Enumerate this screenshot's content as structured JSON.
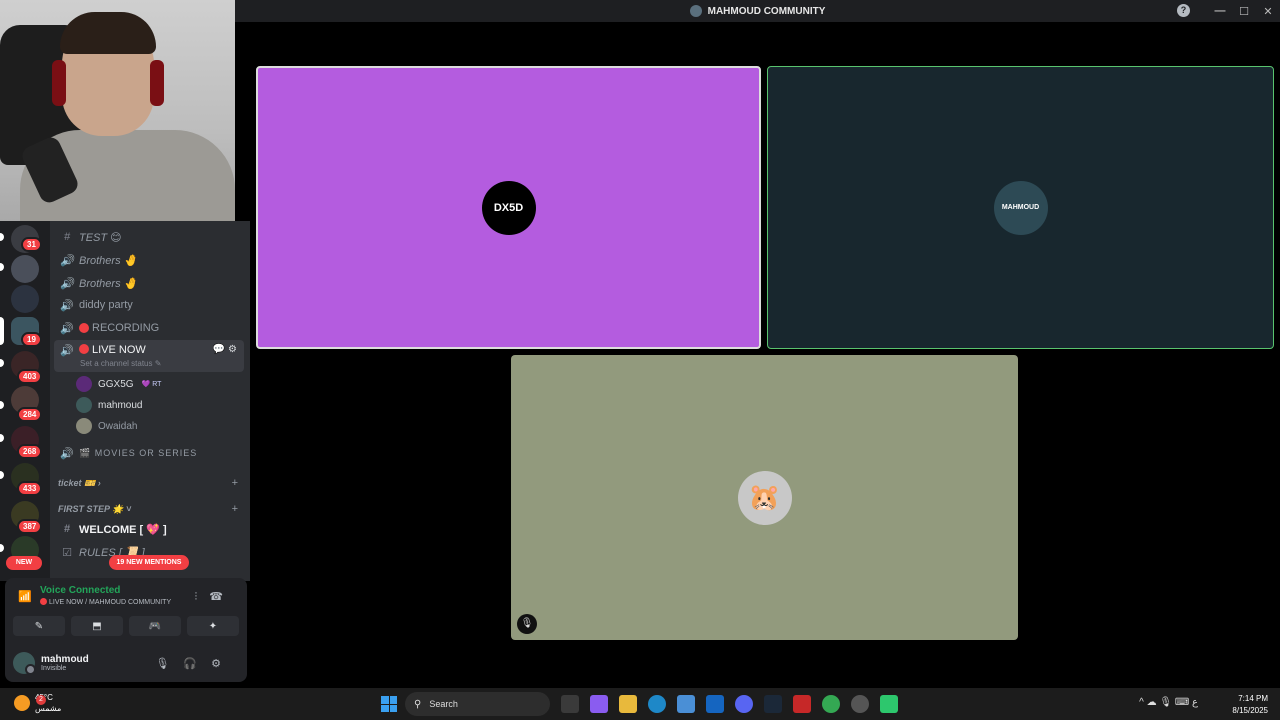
{
  "window": {
    "title": "MAHMOUD COMMUNITY",
    "help": "?",
    "minimize": "—",
    "maximize": "☐",
    "close": "✕"
  },
  "servers": {
    "badges": [
      "31",
      "19",
      "403",
      "284",
      "268",
      "433",
      "387"
    ],
    "new_label": "NEW"
  },
  "channels": {
    "items": [
      {
        "name": "TEST 😊",
        "icon": "#"
      },
      {
        "name": "Brothers 🤚",
        "icon": "🔊"
      },
      {
        "name": "Brothers 🤚",
        "icon": "🔊"
      },
      {
        "name": "diddy party",
        "icon": "🔊"
      },
      {
        "name": "RECORDING",
        "icon": "🔊"
      }
    ],
    "active": {
      "name": "LIVE NOW",
      "status": "Set a channel status ✎",
      "tools": "💬⚙"
    },
    "members": [
      {
        "name": "GGX5G",
        "tag": "💜 RT"
      },
      {
        "name": "mahmoud"
      },
      {
        "name": "Owaidah"
      }
    ],
    "movies": "🎬 MOVIES OR SERIES",
    "ticket_category": "ticket 🎫 ›",
    "first_step_category": "FIRST STEP 🌟 ˅",
    "welcome": "WELCOME [ 💖 ]",
    "rules": "RULES [ 📜 ]",
    "mentions": "19 NEW MENTIONS",
    "plus": "+"
  },
  "voice": {
    "title": "Voice Connected",
    "subtitle": "LIVE NOW / MAHMOUD COMMUNITY",
    "buttons": [
      "✎",
      "⬒",
      "🎮",
      "✦"
    ]
  },
  "user": {
    "name": "mahmoud",
    "status": "Invisible"
  },
  "tiles": {
    "tile1_avatar": "DX5D",
    "tile2_avatar": "MAHMOUD",
    "tile3_avatar": "🐹",
    "mute_icon": "🎙"
  },
  "taskbar": {
    "temp": "45°C",
    "weather_desc": "مشمس",
    "weather_badge": "2",
    "search_placeholder": "Search",
    "tray": "^ ☁ 🎙 ⌨ ع",
    "time": "7:14 PM",
    "date": "8/15/2025"
  }
}
